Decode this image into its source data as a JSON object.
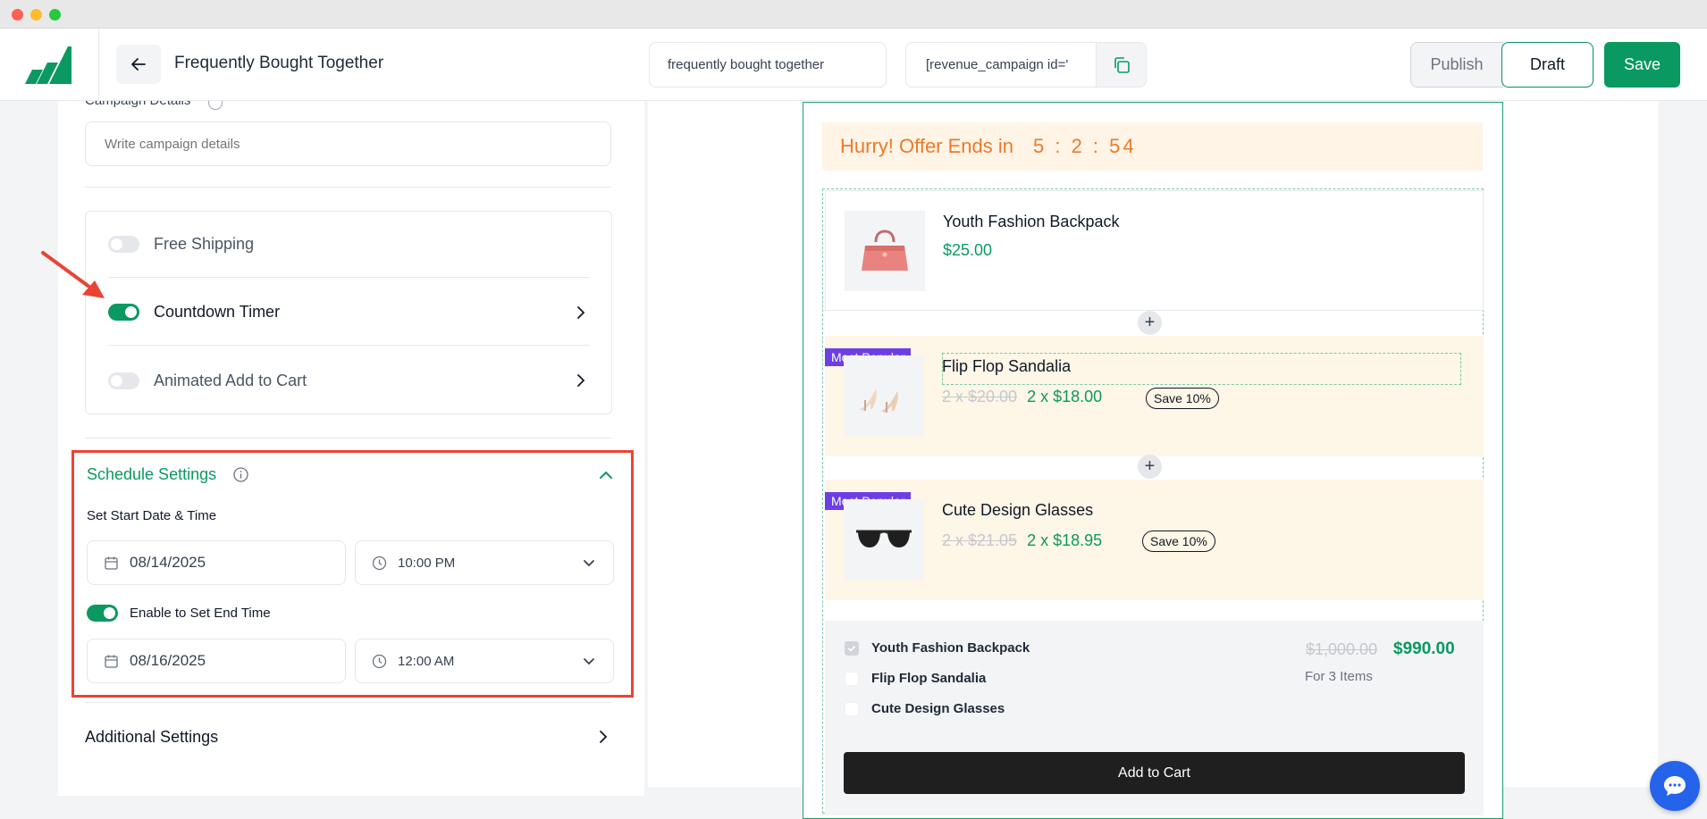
{
  "header": {
    "title": "Frequently Bought Together",
    "campaign_name_value": "frequently bought together",
    "shortcode_value": "[revenue_campaign id='",
    "publish_label": "Publish",
    "draft_label": "Draft",
    "save_label": "Save"
  },
  "left": {
    "campaign_details_label": "Campaign Details",
    "campaign_details_placeholder": "Write campaign details",
    "options": [
      {
        "label": "Free Shipping",
        "enabled": false
      },
      {
        "label": "Countdown Timer",
        "enabled": true
      },
      {
        "label": "Animated Add to Cart",
        "enabled": false
      }
    ],
    "schedule": {
      "title": "Schedule Settings",
      "start_label": "Set Start Date & Time",
      "start_date": "08/14/2025",
      "start_time": "10:00 PM",
      "end_toggle_label": "Enable to Set End Time",
      "end_enabled": true,
      "end_date": "08/16/2025",
      "end_time": "12:00 AM"
    },
    "additional_label": "Additional Settings"
  },
  "preview": {
    "offer_text": "Hurry! Offer Ends in",
    "countdown": "5 : 2 : 54",
    "products": [
      {
        "name": "Youth Fashion Backpack",
        "price": "$25.00",
        "badge": "",
        "old_price": "",
        "save": ""
      },
      {
        "name": "Flip Flop Sandalia",
        "price": "2 x $18.00",
        "old_price": "2 x $20.00",
        "badge": "Most Popular",
        "save": "Save 10%"
      },
      {
        "name": "Cute Design Glasses",
        "price": "2 x $18.95",
        "old_price": "2 x $21.05",
        "badge": "Most Popular",
        "save": "Save 10%"
      }
    ],
    "summary": {
      "items": [
        "Youth Fashion Backpack",
        "Flip Flop Sandalia",
        "Cute Design Glasses"
      ],
      "old_total": "$1,000.00",
      "new_total": "$990.00",
      "note": "For 3 Items",
      "cta": "Add to Cart"
    }
  },
  "colors": {
    "accent": "#0a9960",
    "highlight": "#ea4335",
    "badge": "#6d3ee8",
    "banner_text": "#ea7a2c"
  }
}
